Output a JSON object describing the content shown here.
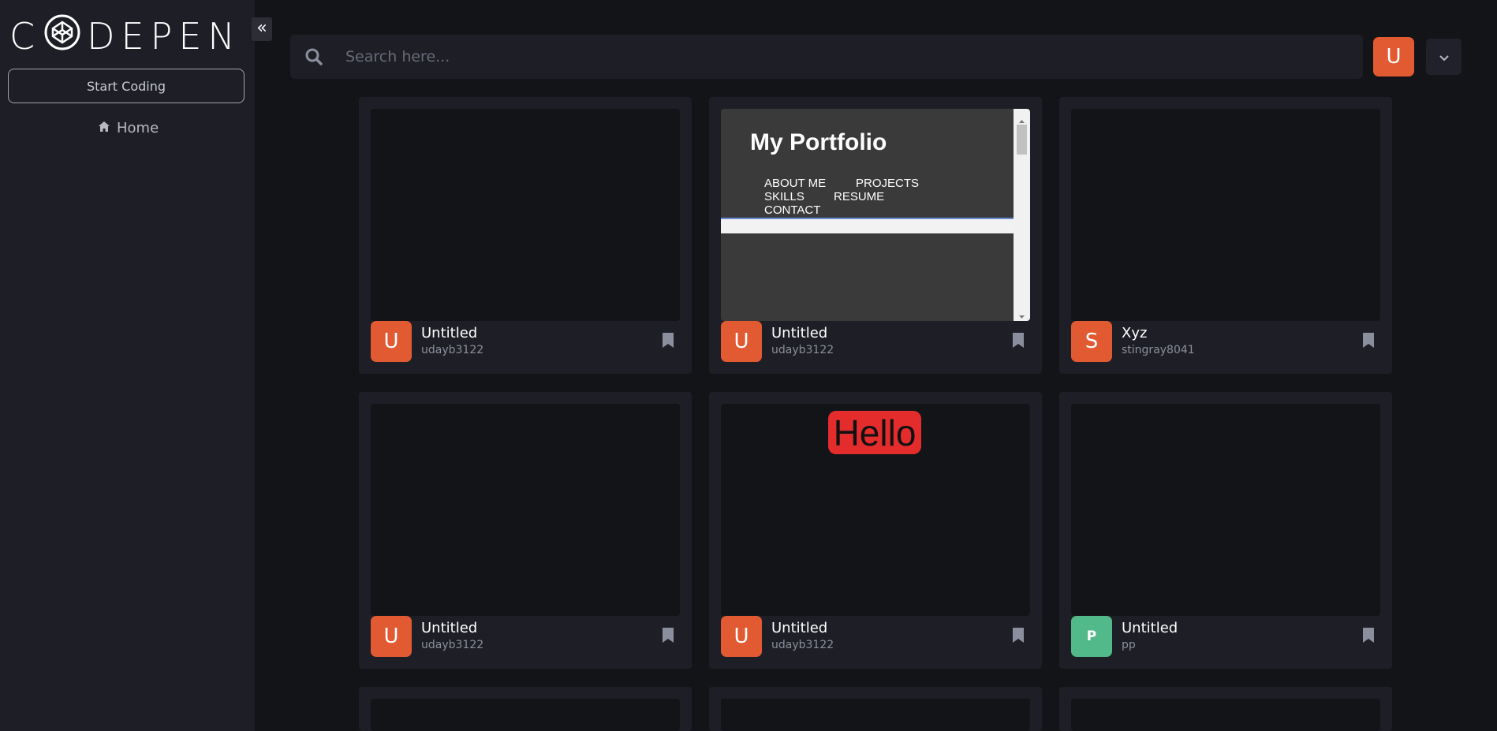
{
  "sidebar": {
    "logo_text_left": "C",
    "logo_text_right": "DEPEN",
    "start_coding": "Start Coding",
    "home": "Home"
  },
  "search": {
    "placeholder": "Search here..."
  },
  "header": {
    "avatar_letter": "U"
  },
  "colors": {
    "accent": "#e15a32",
    "green_avatar": "#52b98a"
  },
  "portfolio": {
    "title": "My Portfolio",
    "nav": [
      "ABOUT ME",
      "PROJECTS",
      "SKILLS",
      "RESUME",
      "CONTACT"
    ]
  },
  "hello_preview": {
    "text": "Hello"
  },
  "cards": [
    {
      "avatar": "U",
      "title": "Untitled",
      "user": "udayb3122"
    },
    {
      "avatar": "U",
      "title": "Untitled",
      "user": "udayb3122"
    },
    {
      "avatar": "S",
      "title": "Xyz",
      "user": "stingray8041"
    },
    {
      "avatar": "U",
      "title": "Untitled",
      "user": "udayb3122"
    },
    {
      "avatar": "U",
      "title": "Untitled",
      "user": "udayb3122"
    },
    {
      "avatar": "P",
      "title": "Untitled",
      "user": "pp"
    }
  ]
}
